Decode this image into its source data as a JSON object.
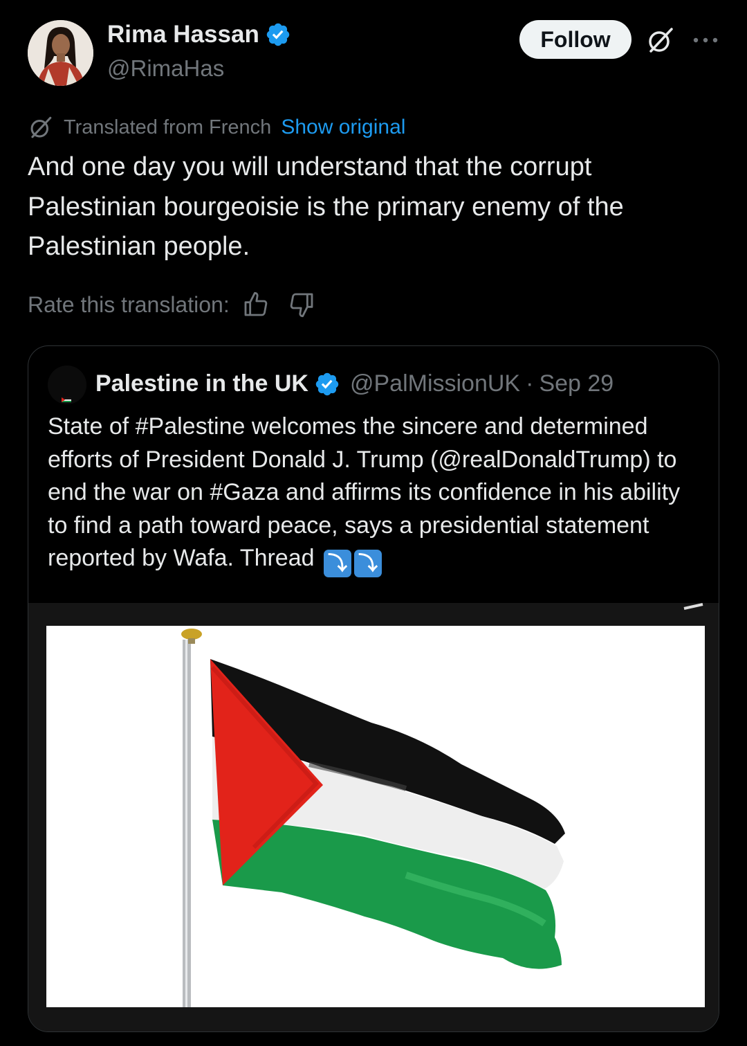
{
  "author": {
    "name": "Rima Hassan",
    "handle": "@RimaHas",
    "verified": true
  },
  "follow_label": "Follow",
  "icons": {
    "grok": "grok-slash-icon",
    "more": "more-dots-icon",
    "translate": "grok-slash-icon",
    "thumb_up": "thumb-up-icon",
    "thumb_down": "thumb-down-icon",
    "verified": "verified-badge-icon"
  },
  "translation": {
    "label": "Translated from French",
    "show_original": "Show original"
  },
  "tweet_text": "And one day you will understand that the corrupt Palestinian bourgeoisie is the primary enemy of the Palestinian people.",
  "rate": {
    "label": "Rate this translation:"
  },
  "quote": {
    "name": "Palestine in the UK",
    "handle": "@PalMissionUK",
    "separator": "·",
    "date": "Sep 29",
    "text": "State of #Palestine welcomes the sincere and determined efforts of President Donald J. Trump (@realDonaldTrump) to end the war on #Gaza and affirms its confidence in his ability to find a path toward peace, says a presidential statement reported by Wafa. Thread",
    "arrows": [
      "⤵",
      "⤵"
    ],
    "media": "palestine-flag-photo"
  },
  "colors": {
    "background": "#000000",
    "text": "#e7e9ea",
    "muted": "#71767b",
    "link": "#1d9bf0",
    "verified": "#1d9bf0",
    "border": "#2f3336",
    "flag_black": "#111111",
    "flag_white": "#f2f2f2",
    "flag_green": "#1a9a4a",
    "flag_red": "#e2231a"
  }
}
